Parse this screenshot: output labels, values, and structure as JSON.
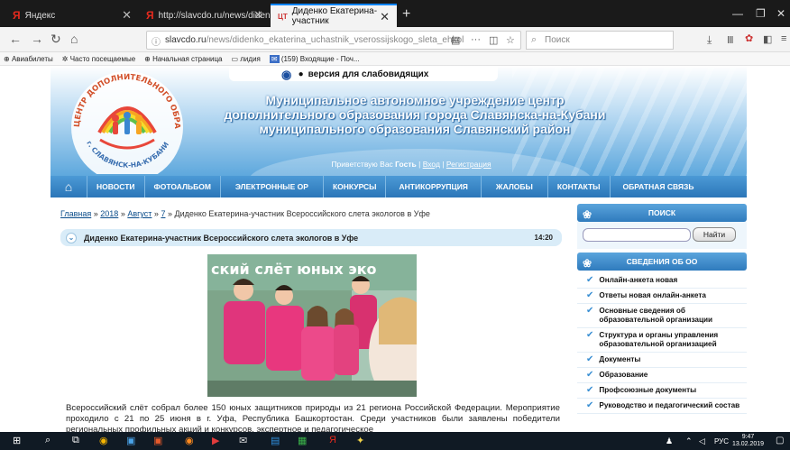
{
  "browser": {
    "tabs": [
      {
        "label": "Яндекс",
        "icon": "yandex-icon"
      },
      {
        "label": "http://slavcdo.ru/news/didenk",
        "icon": "yandex-icon"
      },
      {
        "label": "Диденко Екатерина-участник",
        "icon": "site-icon",
        "prefix": "ЦТ"
      }
    ],
    "new_tab": "+",
    "url_host": "slavcdo.ru",
    "url_path": "/news/didenko_ekaterina_uchastnik_vserossijskogo_sleta_ehkol",
    "url_more": "···",
    "search_placeholder": "Поиск",
    "bookmarks": [
      "Авиабилеты",
      "Часто посещаемые",
      "Начальная страница",
      "лидия",
      "(159) Входящие - Поч..."
    ]
  },
  "site": {
    "vision_label": "версия для слабовидящих",
    "title_lines": [
      "Муниципальное автономное учреждение центр",
      "дополнительного образования города Славянска-на-Кубани",
      "муниципального образования Славянский район"
    ],
    "greet_prefix": "Приветствую Вас ",
    "greet_user": "Гость",
    "greet_login": "Вход",
    "greet_sep": " | ",
    "greet_register": "Регистрация",
    "logo_text_top": "ЦЕНТР ДОПОЛНИТЕЛЬНОГО ОБРАЗОВАНИЯ",
    "logo_text_bottom": "г. СЛАВЯНСК-НА-КУБАНИ",
    "menu": [
      "НОВОСТИ",
      "ФОТОАЛЬБОМ",
      "ЭЛЕКТРОННЫЕ ОР",
      "КОНКУРСЫ",
      "АНТИКОРРУПЦИЯ",
      "ЖАЛОБЫ",
      "КОНТАКТЫ",
      "ОБРАТНАЯ СВЯЗЬ"
    ]
  },
  "article": {
    "crumbs": [
      "Главная",
      "2018",
      "Август",
      "7"
    ],
    "crumb_sep": " » ",
    "crumb_last": "Диденко Екатерина-участник Всероссийского слета экологов в Уфе",
    "title": "Диденко Екатерина-участник Всероссийского слета экологов в Уфе",
    "time": "14:20",
    "photo_banner": "ский слёт юных эко",
    "body": "Всероссийский слёт собрал более 150 юных защитников природы из 21 региона Российской Федерации. Мероприятие проходило с 21 по 25 июня в г. Уфа, Республика Башкортостан. Среди участников были заявлены победители региональных профильных акций и конкурсов, экспертное и педагогическое"
  },
  "sidebar": {
    "search_title": "ПОИСК",
    "search_button": "Найти",
    "info_title": "СВЕДЕНИЯ ОБ ОО",
    "items": [
      "Онлайн-анкета новая",
      "Ответы новая онлайн-анкета",
      "Основные сведения об образовательной организации",
      "Структура и органы управления образовательной организацией",
      "Документы",
      "Образование",
      "Профсоюзные документы",
      "Руководство и педагогический состав"
    ]
  },
  "taskbar": {
    "time": "9:47",
    "date": "13.02.2019",
    "lang": "РУС"
  },
  "colors": {
    "accent": "#2b76b8",
    "header_light": "#b7d9f2",
    "tabbar": "#1a1a1a",
    "taskbar": "#101a24"
  }
}
